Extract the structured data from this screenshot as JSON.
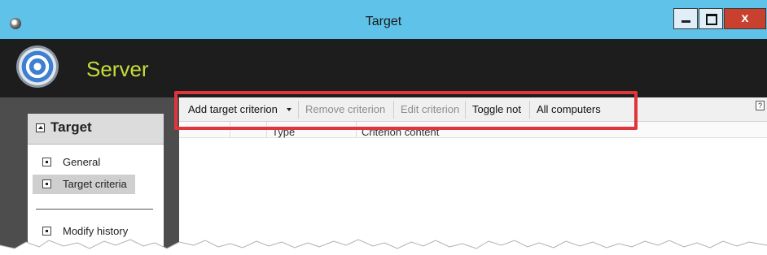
{
  "window": {
    "title": "Target",
    "close_label": "x"
  },
  "app": {
    "name": "Server"
  },
  "sidebar": {
    "title": "Target",
    "items": [
      {
        "label": "General",
        "selected": false
      },
      {
        "label": "Target criteria",
        "selected": true
      },
      {
        "label": "Modify history",
        "selected": false
      }
    ]
  },
  "toolbar": {
    "add_label": "Add target criterion",
    "remove_label": "Remove criterion",
    "edit_label": "Edit criterion",
    "toggle_label": "Toggle not",
    "all_label": "All computers",
    "help_label": "?"
  },
  "grid": {
    "columns": [
      "",
      "",
      "Type",
      "Criterion content"
    ]
  },
  "colors": {
    "titlebar": "#5ec2e9",
    "header": "#1d1d1d",
    "app_name": "#c6dc3a",
    "sidebar": "#4d4d4d",
    "highlight": "#e0353b",
    "close_button": "#c9402f"
  },
  "icons": [
    "app-icon",
    "minimize-icon",
    "maximize-icon",
    "close-icon",
    "target-logo-icon",
    "collapse-icon",
    "nav-item-icon",
    "dropdown-arrow-icon",
    "help-icon"
  ]
}
